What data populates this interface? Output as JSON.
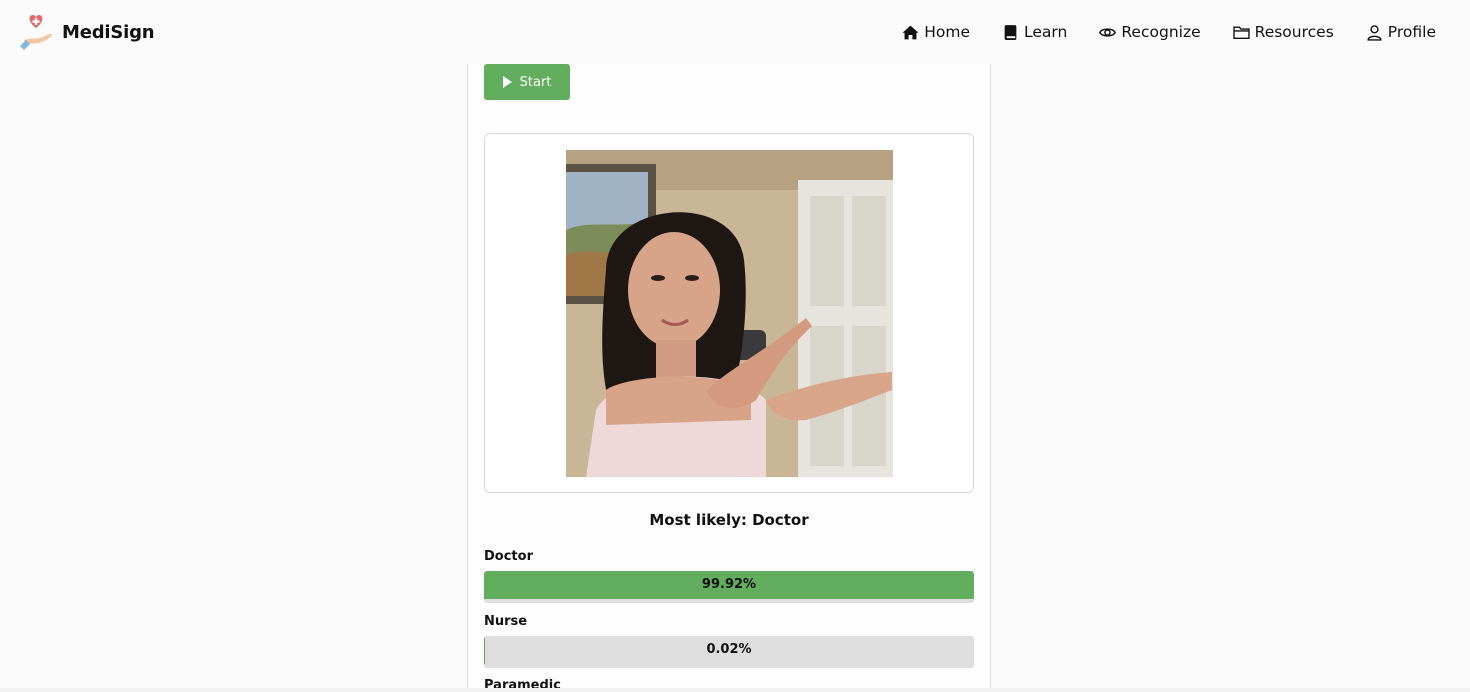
{
  "header": {
    "brand_name": "MediSign",
    "nav": [
      {
        "label": "Home",
        "icon": "home-icon"
      },
      {
        "label": "Learn",
        "icon": "book-icon"
      },
      {
        "label": "Recognize",
        "icon": "eye-icon"
      },
      {
        "label": "Resources",
        "icon": "folder-icon"
      },
      {
        "label": "Profile",
        "icon": "user-icon"
      }
    ]
  },
  "controls": {
    "start_label": "Start"
  },
  "result": {
    "title": "Most likely: Doctor",
    "predictions": [
      {
        "label": "Doctor",
        "value_text": "99.92%",
        "value": 99.92
      },
      {
        "label": "Nurse",
        "value_text": "0.02%",
        "value": 0.02
      },
      {
        "label": "Paramedic"
      }
    ]
  },
  "colors": {
    "accent": "#63ad5e",
    "track": "#dedede",
    "logo_heart": "#e0686c"
  }
}
